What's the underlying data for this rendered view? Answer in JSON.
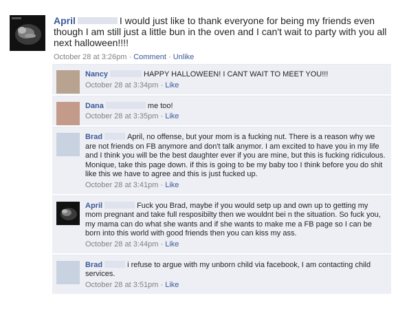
{
  "post": {
    "author": "April",
    "text": "I would just like to thank everyone for being my friends even though I am still just a little bun in the oven and I can't wait to party with you all next halloween!!!!",
    "time": "October 28 at 3:26pm",
    "sep": "·",
    "comment_label": "Comment",
    "unlike_label": "Unlike"
  },
  "comments": [
    {
      "author": "Nancy",
      "text": "HAPPY HALLOWEEN! I CANT WAIT TO MEET YOU!!!",
      "time": "October 28 at 3:34pm",
      "like_label": "Like",
      "avatar_color": "#b7a38f"
    },
    {
      "author": "Dana",
      "text": "me too!",
      "time": "October 28 at 3:35pm",
      "like_label": "Like",
      "avatar_color": "#c49a8a"
    },
    {
      "author": "Brad",
      "text": "April, no offense, but your mom is a fucking nut. There is a reason why we are not friends on FB anymore and don't talk anymor. I am excited to have you in my life and I think you will be the best daughter ever if you are mine, but this is fucking ridiculous. Monique, take this page down. if this is going to be my baby too I think before you do shit like this we have to agree and this is just fucked up.",
      "time": "October 28 at 3:41pm",
      "like_label": "Like",
      "avatar_color": "#c9d2e0"
    },
    {
      "author": "April",
      "text": "Fuck you Brad, maybe if you would setp up and own up to getting my mom pregnant and take full resposibilty then we wouldnt bei n the situation. So fuck you, my mama can do what she wants and if she wants to make me a FB page so I can be born into this world with good friends then you can kiss my ass.",
      "time": "October 28 at 3:44pm",
      "like_label": "Like",
      "avatar_color": "#1d1d1d"
    },
    {
      "author": "Brad",
      "text": "i refuse to argue with my unborn child via facebook, I am contacting child services.",
      "time": "October 28 at 3:51pm",
      "like_label": "Like",
      "avatar_color": "#c9d2e0"
    }
  ]
}
